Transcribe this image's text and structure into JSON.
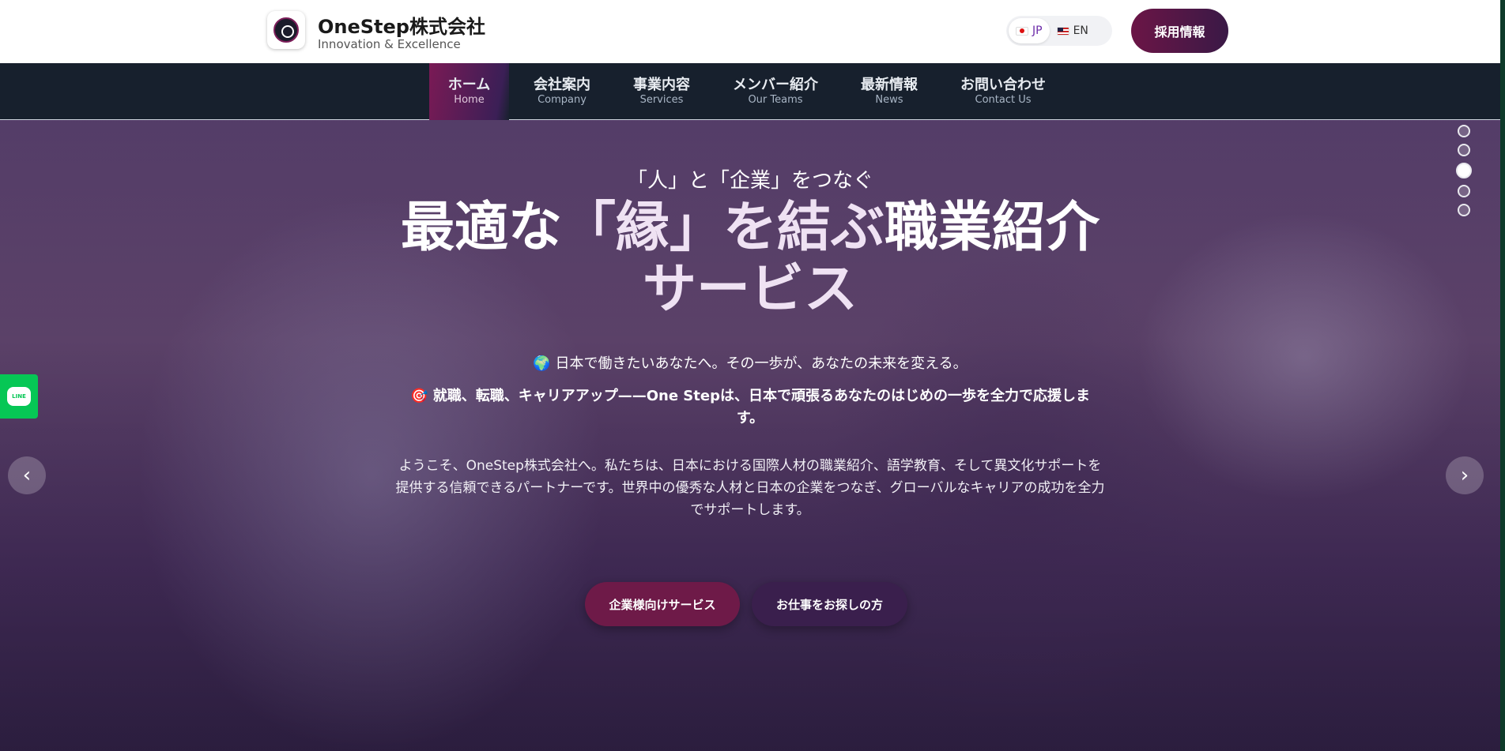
{
  "header": {
    "brand_name": "OneStep株式会社",
    "brand_tagline": "Innovation & Excellence",
    "languages": [
      {
        "code": "JP",
        "icon": "jp-flag-icon",
        "active": true
      },
      {
        "code": "EN",
        "icon": "us-flag-icon",
        "active": false
      }
    ],
    "recruit_label": "採用情報"
  },
  "nav": {
    "items": [
      {
        "jp": "ホーム",
        "en": "Home",
        "active": true
      },
      {
        "jp": "会社案内",
        "en": "Company"
      },
      {
        "jp": "事業内容",
        "en": "Services"
      },
      {
        "jp": "メンバー紹介",
        "en": "Our Teams"
      },
      {
        "jp": "最新情報",
        "en": "News"
      },
      {
        "jp": "お問い合わせ",
        "en": "Contact Us"
      }
    ]
  },
  "hero": {
    "eyebrow": "「人」と「企業」をつなぐ",
    "headline_part1": "最適な",
    "headline_part2": "「縁」を結ぶ",
    "headline_part3": "職業紹介",
    "headline_part4": "サービス",
    "line1": "🌍 日本で働きたいあなたへ。その一歩が、あなたの未来を変える。",
    "line2": "🎯 就職、転職、キャリアアップ——One Stepは、日本で頑張るあなたのはじめの一歩を全力で応援します。",
    "paragraph": "ようこそ、OneStep株式会社へ。私たちは、日本における国際人材の職業紹介、語学教育、そして異文化サポートを提供する信頼できるパートナーです。世界中の優秀な人材と日本の企業をつなぎ、グローバルなキャリアの成功を全力でサポートします。",
    "cta_primary": "企業様向けサービス",
    "cta_secondary": "お仕事をお探しの方",
    "slide_count": 5,
    "active_slide": 3
  },
  "line_widget": {
    "label": "LINE",
    "icon": "line-icon"
  },
  "colors": {
    "brand": "#6e1a48",
    "nav_bg": "#17202d",
    "line_green": "#06c755"
  }
}
